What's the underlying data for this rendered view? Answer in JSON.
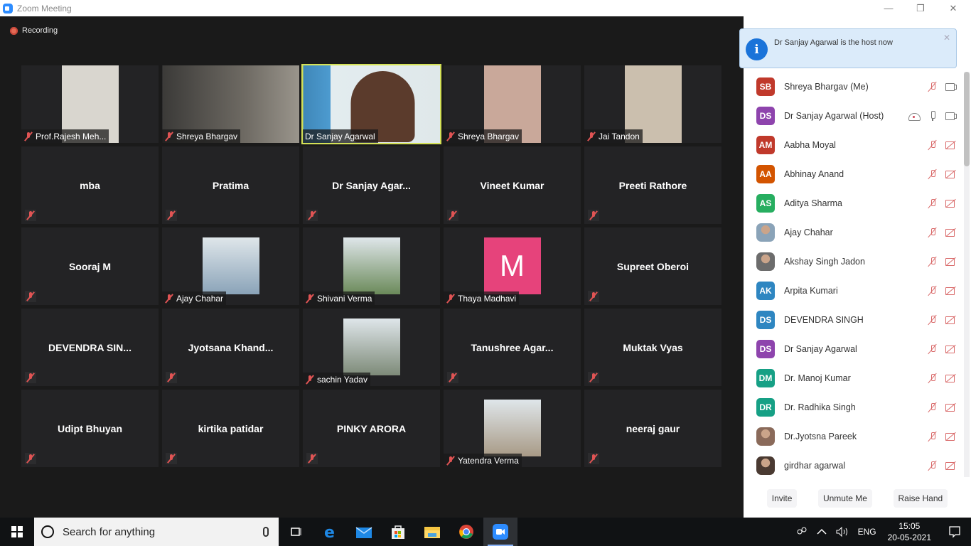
{
  "window": {
    "title": "Zoom Meeting",
    "minimize": "—",
    "restore": "❐",
    "close": "✕"
  },
  "meeting": {
    "recording_label": "Recording",
    "tiles": [
      {
        "name": "Prof.Rajesh Meh...",
        "type": "video",
        "muted": true,
        "bg": "#d9d6cf"
      },
      {
        "name": "Shreya Bhargav",
        "type": "video-wide",
        "muted": true,
        "bg": "#4a4845"
      },
      {
        "name": "Dr Sanjay Agarwal",
        "type": "video-active",
        "muted": false,
        "bg": "#6aa3c7"
      },
      {
        "name": "Shreya Bhargav",
        "type": "video",
        "muted": true,
        "bg": "#c9a89a"
      },
      {
        "name": "Jai Tandon",
        "type": "video",
        "muted": true,
        "bg": "#cbbfae"
      },
      {
        "name": "mba",
        "type": "name",
        "muted": true
      },
      {
        "name": "Pratima",
        "type": "name",
        "muted": true
      },
      {
        "name": "Dr  Sanjay  Agar...",
        "type": "name",
        "muted": true
      },
      {
        "name": "Vineet Kumar",
        "type": "name",
        "muted": true
      },
      {
        "name": "Preeti Rathore",
        "type": "name",
        "muted": true
      },
      {
        "name": "Sooraj M",
        "type": "name",
        "muted": true
      },
      {
        "name": "Ajay Chahar",
        "type": "photo",
        "muted": true,
        "bg": "#8aa3b8"
      },
      {
        "name": "Shivani Verma",
        "type": "photo",
        "muted": true,
        "bg": "#6b8a5a"
      },
      {
        "name": "Thaya Madhavi",
        "type": "letter",
        "letter": "M",
        "muted": true,
        "bg": "#e6437b"
      },
      {
        "name": "Supreet Oberoi",
        "type": "name",
        "muted": true
      },
      {
        "name": "DEVENDRA  SIN...",
        "type": "name",
        "muted": true
      },
      {
        "name": "Jyotsana  Khand...",
        "type": "name",
        "muted": true
      },
      {
        "name": "sachin Yadav",
        "type": "photo",
        "muted": true,
        "bg": "#7d8a78"
      },
      {
        "name": "Tanushree  Agar...",
        "type": "name",
        "muted": true
      },
      {
        "name": "Muktak Vyas",
        "type": "name",
        "muted": true
      },
      {
        "name": "Udipt Bhuyan",
        "type": "name",
        "muted": true
      },
      {
        "name": "kirtika patidar",
        "type": "name",
        "muted": true
      },
      {
        "name": "PINKY ARORA",
        "type": "name",
        "muted": true
      },
      {
        "name": "Yatendra Verma",
        "type": "photo",
        "muted": true,
        "bg": "#a89a86"
      },
      {
        "name": "neeraj gaur",
        "type": "name",
        "muted": true
      }
    ]
  },
  "notification": {
    "icon": "info-icon",
    "message": "Dr Sanjay Agarwal is the host now",
    "close": "✕"
  },
  "participants": [
    {
      "initials": "SB",
      "color": "#c0392b",
      "name": "Shreya Bhargav (Me)",
      "mic": "muted",
      "cam": "on"
    },
    {
      "initials": "DS",
      "color": "#8e44ad",
      "name": "Dr Sanjay Agarwal (Host)",
      "mic": "on",
      "cam": "on",
      "cloud": true
    },
    {
      "initials": "AM",
      "color": "#c0392b",
      "name": "Aabha Moyal",
      "mic": "muted",
      "cam": "off"
    },
    {
      "initials": "AA",
      "color": "#d35400",
      "name": "Abhinay Anand",
      "mic": "muted",
      "cam": "off"
    },
    {
      "initials": "AS",
      "color": "#27ae60",
      "name": "Aditya Sharma",
      "mic": "muted",
      "cam": "off"
    },
    {
      "initials": "",
      "color": "#8aa3b8",
      "name": "Ajay Chahar",
      "mic": "muted",
      "cam": "off",
      "photo": true
    },
    {
      "initials": "",
      "color": "#6c6c6c",
      "name": "Akshay Singh Jadon",
      "mic": "muted",
      "cam": "off",
      "photo": true
    },
    {
      "initials": "AK",
      "color": "#2e86c1",
      "name": "Arpita Kumari",
      "mic": "muted",
      "cam": "off"
    },
    {
      "initials": "DS",
      "color": "#2e86c1",
      "name": "DEVENDRA SINGH",
      "mic": "muted",
      "cam": "off"
    },
    {
      "initials": "DS",
      "color": "#8e44ad",
      "name": "Dr Sanjay Agarwal",
      "mic": "muted",
      "cam": "off"
    },
    {
      "initials": "DM",
      "color": "#16a085",
      "name": "Dr. Manoj Kumar",
      "mic": "muted",
      "cam": "off"
    },
    {
      "initials": "DR",
      "color": "#16a085",
      "name": "Dr. Radhika Singh",
      "mic": "muted",
      "cam": "off"
    },
    {
      "initials": "",
      "color": "#8a6a5a",
      "name": "Dr.Jyotsna Pareek",
      "mic": "muted",
      "cam": "off",
      "photo": true
    },
    {
      "initials": "",
      "color": "#4a3a32",
      "name": "girdhar agarwal",
      "mic": "muted",
      "cam": "off",
      "photo": true
    }
  ],
  "panel_footer": {
    "invite": "Invite",
    "unmute": "Unmute Me",
    "raise_hand": "Raise Hand"
  },
  "taskbar": {
    "search_placeholder": "Search for anything",
    "apps": [
      "task-view-icon",
      "edge-icon",
      "mail-icon",
      "store-icon",
      "file-explorer-icon",
      "chrome-icon",
      "zoom-icon"
    ],
    "language": "ENG",
    "time": "15:05",
    "date": "20-05-2021"
  }
}
